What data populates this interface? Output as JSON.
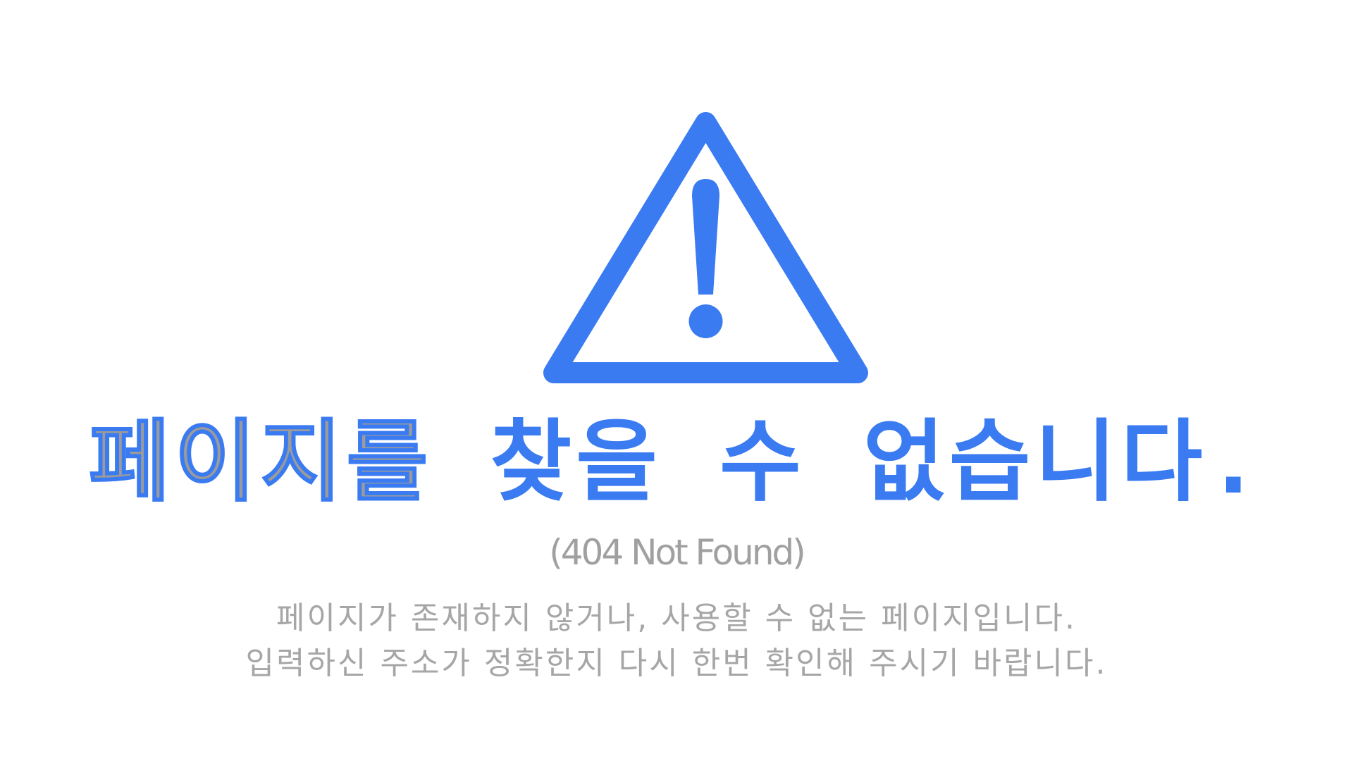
{
  "warning": {
    "icon": "warning-triangle-icon",
    "color": "#3a7bf2"
  },
  "heading": {
    "part1": "페이지를",
    "part2": "찾을 수 없습니다.",
    "gray_color": "#9b9b9b",
    "blue_color": "#3a7bf2"
  },
  "subheading": "(404 Not Found)",
  "description": {
    "line1": "페이지가 존재하지 않거나, 사용할 수 없는 페이지입니다.",
    "line2": "입력하신 주소가 정확한지 다시 한번 확인해 주시기 바랍니다."
  }
}
